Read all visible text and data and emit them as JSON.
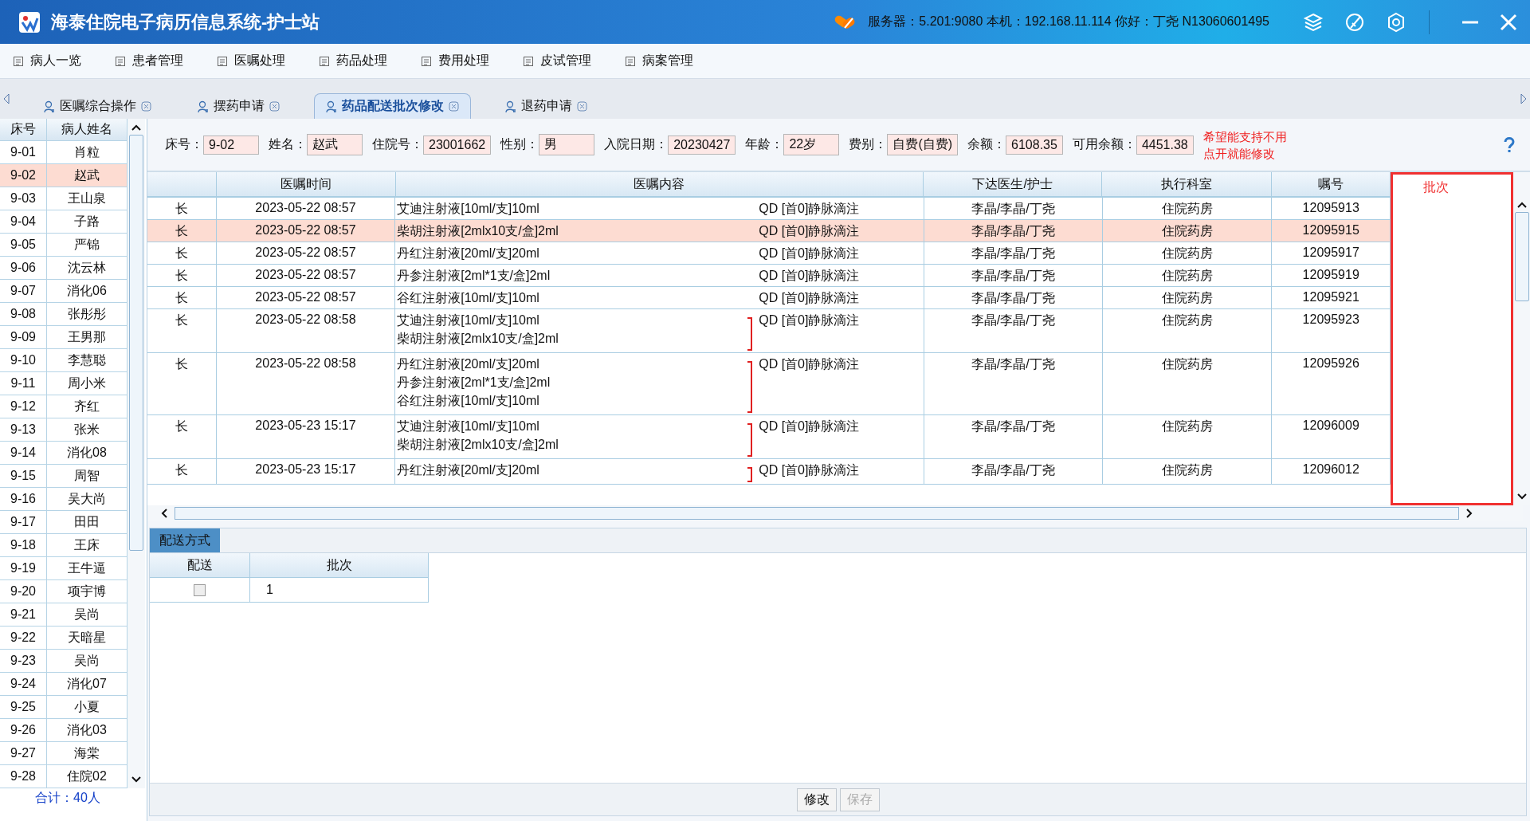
{
  "window": {
    "title": "海泰住院电子病历信息系统-护士站",
    "status": "服务器：5.201:9080 本机：192.168.11.114 你好：丁尧 N13060601495"
  },
  "menu": [
    "病人一览",
    "患者管理",
    "医嘱处理",
    "药品处理",
    "费用处理",
    "皮试管理",
    "病案管理"
  ],
  "tabs": [
    {
      "label": "医嘱综合操作",
      "selected": false
    },
    {
      "label": "摆药申请",
      "selected": false
    },
    {
      "label": "药品配送批次修改",
      "selected": true
    },
    {
      "label": "退药申请",
      "selected": false
    }
  ],
  "patients": {
    "columns": [
      "床号",
      "病人姓名"
    ],
    "rows": [
      {
        "bed": "9-01",
        "name": "肖粒",
        "selected": false
      },
      {
        "bed": "9-02",
        "name": "赵武",
        "selected": true
      },
      {
        "bed": "9-03",
        "name": "王山泉",
        "selected": false
      },
      {
        "bed": "9-04",
        "name": "子路",
        "selected": false
      },
      {
        "bed": "9-05",
        "name": "严锦",
        "selected": false
      },
      {
        "bed": "9-06",
        "name": "沈云林",
        "selected": false
      },
      {
        "bed": "9-07",
        "name": "消化06",
        "selected": false
      },
      {
        "bed": "9-08",
        "name": "张彤彤",
        "selected": false
      },
      {
        "bed": "9-09",
        "name": "王男那",
        "selected": false
      },
      {
        "bed": "9-10",
        "name": "李慧聪",
        "selected": false
      },
      {
        "bed": "9-11",
        "name": "周小米",
        "selected": false
      },
      {
        "bed": "9-12",
        "name": "齐红",
        "selected": false
      },
      {
        "bed": "9-13",
        "name": "张米",
        "selected": false
      },
      {
        "bed": "9-14",
        "name": "消化08",
        "selected": false
      },
      {
        "bed": "9-15",
        "name": "周智",
        "selected": false
      },
      {
        "bed": "9-16",
        "name": "吴大尚",
        "selected": false
      },
      {
        "bed": "9-17",
        "name": "田田",
        "selected": false
      },
      {
        "bed": "9-18",
        "name": "王床",
        "selected": false
      },
      {
        "bed": "9-19",
        "name": "王牛逼",
        "selected": false
      },
      {
        "bed": "9-20",
        "name": "项宇博",
        "selected": false
      },
      {
        "bed": "9-21",
        "name": "吴尚",
        "selected": false
      },
      {
        "bed": "9-22",
        "name": "天暗星",
        "selected": false
      },
      {
        "bed": "9-23",
        "name": "吴尚",
        "selected": false
      },
      {
        "bed": "9-24",
        "name": "消化07",
        "selected": false
      },
      {
        "bed": "9-25",
        "name": "小夏",
        "selected": false
      },
      {
        "bed": "9-26",
        "name": "消化03",
        "selected": false
      },
      {
        "bed": "9-27",
        "name": "海棠",
        "selected": false
      },
      {
        "bed": "9-28",
        "name": "住院02",
        "selected": false
      }
    ],
    "total": "合计：40人"
  },
  "patient_info": [
    {
      "label": "床号：",
      "value": "9-02"
    },
    {
      "label": "姓名：",
      "value": "赵武"
    },
    {
      "label": "住院号：",
      "value": "23001662"
    },
    {
      "label": "性别：",
      "value": "男"
    },
    {
      "label": "入院日期：",
      "value": "20230427"
    },
    {
      "label": "年龄：",
      "value": "22岁"
    },
    {
      "label": "费别：",
      "value": "自费(自费)"
    },
    {
      "label": "余额：",
      "value": "6108.35"
    },
    {
      "label": "可用余额：",
      "value": "4451.38"
    }
  ],
  "note": "希望能支持不用点开就能修改",
  "orders": {
    "columns": [
      "医嘱时间",
      "医嘱内容",
      "下达医生/护士",
      "执行科室",
      "嘱号",
      "批次"
    ],
    "rows": [
      {
        "type": "长",
        "time": "2023-05-22 08:57",
        "items": [
          "艾迪注射液[10ml/支]10ml"
        ],
        "grouped": false,
        "usage": "QD [首0]静脉滴注",
        "doctor": "李晶/李晶/丁尧",
        "dept": "住院药房",
        "order_no": "12095913",
        "selected": false
      },
      {
        "type": "长",
        "time": "2023-05-22 08:57",
        "items": [
          "柴胡注射液[2mlx10支/盒]2ml"
        ],
        "grouped": false,
        "usage": "QD [首0]静脉滴注",
        "doctor": "李晶/李晶/丁尧",
        "dept": "住院药房",
        "order_no": "12095915",
        "selected": true
      },
      {
        "type": "长",
        "time": "2023-05-22 08:57",
        "items": [
          "丹红注射液[20ml/支]20ml"
        ],
        "grouped": false,
        "usage": "QD [首0]静脉滴注",
        "doctor": "李晶/李晶/丁尧",
        "dept": "住院药房",
        "order_no": "12095917",
        "selected": false
      },
      {
        "type": "长",
        "time": "2023-05-22 08:57",
        "items": [
          "丹参注射液[2ml*1支/盒]2ml"
        ],
        "grouped": false,
        "usage": "QD [首0]静脉滴注",
        "doctor": "李晶/李晶/丁尧",
        "dept": "住院药房",
        "order_no": "12095919",
        "selected": false
      },
      {
        "type": "长",
        "time": "2023-05-22 08:57",
        "items": [
          "谷红注射液[10ml/支]10ml"
        ],
        "grouped": false,
        "usage": "QD [首0]静脉滴注",
        "doctor": "李晶/李晶/丁尧",
        "dept": "住院药房",
        "order_no": "12095921",
        "selected": false
      },
      {
        "type": "长",
        "time": "2023-05-22 08:58",
        "items": [
          "艾迪注射液[10ml/支]10ml",
          "柴胡注射液[2mlx10支/盒]2ml"
        ],
        "grouped": true,
        "usage": "QD [首0]静脉滴注",
        "doctor": "李晶/李晶/丁尧",
        "dept": "住院药房",
        "order_no": "12095923",
        "selected": false
      },
      {
        "type": "长",
        "time": "2023-05-22 08:58",
        "items": [
          "丹红注射液[20ml/支]20ml",
          "丹参注射液[2ml*1支/盒]2ml",
          "谷红注射液[10ml/支]10ml"
        ],
        "grouped": true,
        "usage": "QD [首0]静脉滴注",
        "doctor": "李晶/李晶/丁尧",
        "dept": "住院药房",
        "order_no": "12095926",
        "selected": false
      },
      {
        "type": "长",
        "time": "2023-05-23 15:17",
        "items": [
          "艾迪注射液[10ml/支]10ml",
          "柴胡注射液[2mlx10支/盒]2ml"
        ],
        "grouped": true,
        "usage": "QD [首0]静脉滴注",
        "doctor": "李晶/李晶/丁尧",
        "dept": "住院药房",
        "order_no": "12096009",
        "selected": false
      },
      {
        "type": "长",
        "time": "2023-05-23 15:17",
        "items": [
          "丹红注射液[20ml/支]20ml"
        ],
        "grouped": true,
        "usage": "QD [首0]静脉滴注",
        "doctor": "李晶/李晶/丁尧",
        "dept": "住院药房",
        "order_no": "12096012",
        "selected": false
      }
    ]
  },
  "delivery": {
    "tab": {
      "label": "配送方式",
      "selected": true
    },
    "columns": [
      "配送",
      "批次"
    ],
    "rows": [
      {
        "checked": false,
        "batch": "1"
      }
    ]
  },
  "buttons": [
    {
      "label": "修改",
      "disabled": false
    },
    {
      "label": "保存",
      "disabled": true
    }
  ]
}
